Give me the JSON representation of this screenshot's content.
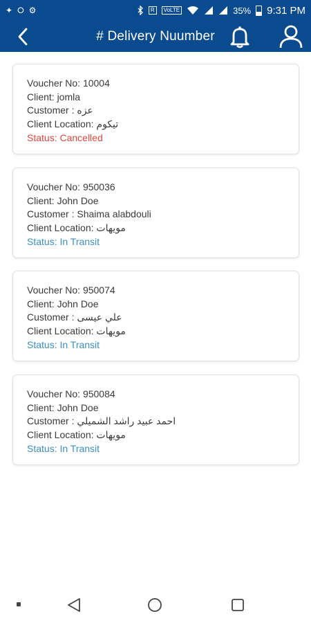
{
  "status_bar": {
    "left_icons": [
      "✦",
      "⭘",
      "⚙"
    ],
    "box_label": "R",
    "volte_label": "VoLTE",
    "battery_percent": "35%",
    "time": "9:31 PM"
  },
  "header": {
    "title": "# Delivery Nuumber",
    "background_color": "#0a4a8f"
  },
  "cards": [
    {
      "voucher": "Voucher No: 10004",
      "client": "Client: jomla",
      "customer": "Customer : عزه",
      "location": "Client Location: تيكوم",
      "status": "Status: Cancelled",
      "status_color": "#e0483e"
    },
    {
      "voucher": "Voucher No: 950036",
      "client": "Client: John Doe",
      "customer": "Customer : Shaima alabdouli",
      "location": "Client Location: مويهات",
      "status": "Status: In Transit",
      "status_color": "#3a8fc4"
    },
    {
      "voucher": "Voucher No: 950074",
      "client": "Client: John Doe",
      "customer": "Customer : علي عيسى",
      "location": "Client Location: مويهات",
      "status": "Status: In Transit",
      "status_color": "#3a8fc4"
    },
    {
      "voucher": "Voucher No: 950084",
      "client": "Client: John Doe",
      "customer": "Customer : احمد عبيد راشد الشميلي",
      "location": "Client Location: مويهات",
      "status": "Status: In Transit",
      "status_color": "#3a8fc4"
    }
  ],
  "icons": {
    "back": "back-arrow-icon",
    "bell": "bell-icon",
    "user": "user-icon",
    "nav_back": "triangle-back-icon",
    "nav_home": "circle-home-icon",
    "nav_recent": "square-recent-icon"
  }
}
